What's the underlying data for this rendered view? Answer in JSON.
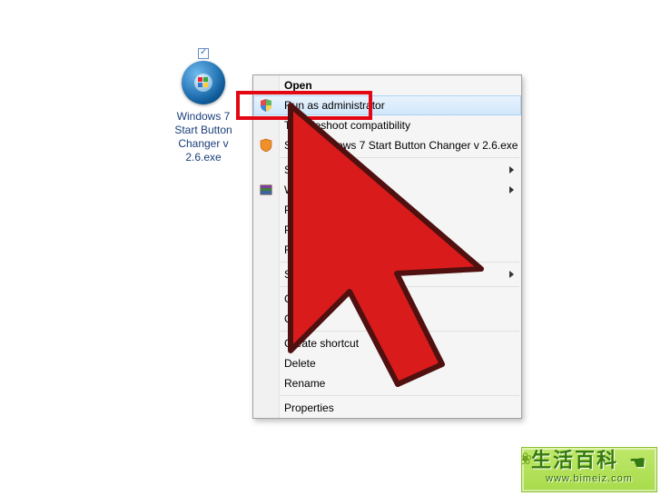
{
  "desktop_icon": {
    "label": "Windows 7 Start Button Changer v 2.6.exe",
    "selected": true
  },
  "context_menu": {
    "items": [
      {
        "kind": "item",
        "label": "Open",
        "bold": true
      },
      {
        "kind": "item",
        "label": "Run as administrator",
        "icon": "shield",
        "hover": true,
        "highlight": true
      },
      {
        "kind": "item",
        "label": "Troubleshoot compatibility"
      },
      {
        "kind": "item",
        "label": "Scan Windows 7 Start Button Changer v 2.6.exe",
        "icon": "shield-orange"
      },
      {
        "kind": "sep"
      },
      {
        "kind": "item",
        "label": "Share with",
        "submenu": true
      },
      {
        "kind": "item",
        "label": "WinRAR",
        "icon": "winrar",
        "submenu": true
      },
      {
        "kind": "item",
        "label": "Pin to Taskbar"
      },
      {
        "kind": "item",
        "label": "Pin to Start Menu"
      },
      {
        "kind": "item",
        "label": "Restore previous versions"
      },
      {
        "kind": "sep"
      },
      {
        "kind": "item",
        "label": "Send to",
        "submenu": true
      },
      {
        "kind": "sep"
      },
      {
        "kind": "item",
        "label": "Cut"
      },
      {
        "kind": "item",
        "label": "Copy"
      },
      {
        "kind": "sep"
      },
      {
        "kind": "item",
        "label": "Create shortcut"
      },
      {
        "kind": "item",
        "label": "Delete"
      },
      {
        "kind": "item",
        "label": "Rename"
      },
      {
        "kind": "sep"
      },
      {
        "kind": "item",
        "label": "Properties"
      }
    ]
  },
  "watermark": {
    "title": "生活百科",
    "url": "www.bimeiz.com"
  }
}
